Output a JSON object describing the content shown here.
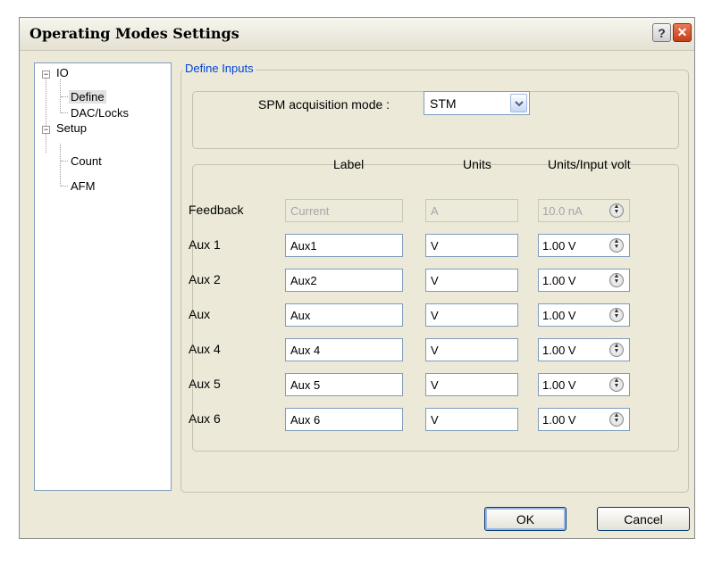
{
  "window": {
    "title": "Operating Modes Settings"
  },
  "titlebar_buttons": {
    "help": "?",
    "close": "✕"
  },
  "tree": {
    "io": "IO",
    "define": "Define",
    "dac_locks": "DAC/Locks",
    "setup": "Setup",
    "count": "Count",
    "afm": "AFM"
  },
  "define_inputs": {
    "legend": "Define Inputs",
    "mode_label": "SPM acquisition mode :",
    "mode_value": "STM",
    "headers": {
      "label": "Label",
      "units": "Units",
      "units_per_volt": "Units/Input volt"
    },
    "rows": [
      {
        "name": "Feedback",
        "label": "Current",
        "units": "A",
        "scale": "10.0 nA",
        "disabled": true
      },
      {
        "name": "Aux 1",
        "label": "Aux1",
        "units": "V",
        "scale": "1.00 V",
        "disabled": false
      },
      {
        "name": "Aux 2",
        "label": "Aux2",
        "units": "V",
        "scale": "1.00 V",
        "disabled": false
      },
      {
        "name": "Aux",
        "label": "Aux",
        "units": "V",
        "scale": "1.00 V",
        "disabled": false
      },
      {
        "name": "Aux 4",
        "label": "Aux 4",
        "units": "V",
        "scale": "1.00 V",
        "disabled": false
      },
      {
        "name": "Aux 5",
        "label": "Aux 5",
        "units": "V",
        "scale": "1.00 V",
        "disabled": false
      },
      {
        "name": "Aux 6",
        "label": "Aux 6",
        "units": "V",
        "scale": "1.00 V",
        "disabled": false
      }
    ]
  },
  "buttons": {
    "ok": "OK",
    "cancel": "Cancel"
  },
  "colors": {
    "accent": "#0046d5",
    "close": "#c43e17",
    "field_border": "#7f9db9"
  }
}
